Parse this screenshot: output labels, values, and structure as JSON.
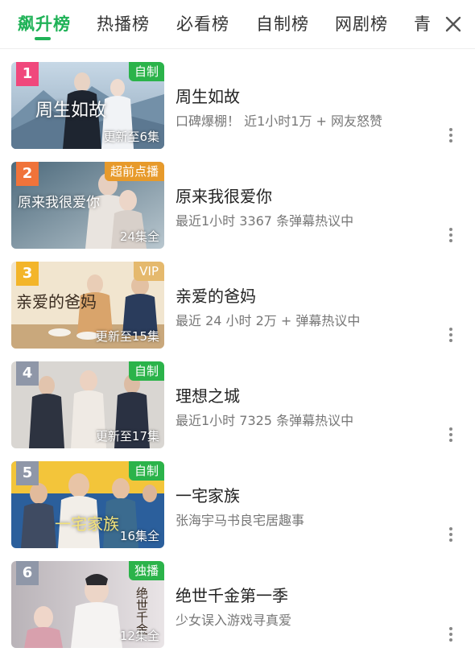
{
  "tabs": [
    {
      "label": "飙升榜",
      "active": true
    },
    {
      "label": "热播榜",
      "active": false
    },
    {
      "label": "必看榜",
      "active": false
    },
    {
      "label": "自制榜",
      "active": false
    },
    {
      "label": "网剧榜",
      "active": false
    },
    {
      "label": "青",
      "active": false
    }
  ],
  "colors": {
    "accent": "#1fb257"
  },
  "items": [
    {
      "rank": "1",
      "rank_color": "#f0487c",
      "badge": "自制",
      "badge_color": "#2bb34a",
      "episodes": "更新至6集",
      "poster_text": "周生如故",
      "title": "周生如故",
      "desc": "口碑爆棚！ 近1小时1万 + 网友怒赞"
    },
    {
      "rank": "2",
      "rank_color": "#f0733a",
      "badge": "超前点播",
      "badge_color": "#e79a2b",
      "episodes": "24集全",
      "poster_text": "原来我很爱你",
      "title": "原来我很爱你",
      "desc": "最近1小时 3367 条弹幕热议中"
    },
    {
      "rank": "3",
      "rank_color": "#f3b52a",
      "badge": "VIP",
      "badge_color": "#e5b96d",
      "episodes": "更新至15集",
      "poster_text": "亲爱的爸妈",
      "title": "亲爱的爸妈",
      "desc": "最近 24 小时 2万 + 弹幕热议中"
    },
    {
      "rank": "4",
      "rank_color": "#8f97a8",
      "badge": "自制",
      "badge_color": "#2bb34a",
      "episodes": "更新至17集",
      "poster_text": "",
      "title": "理想之城",
      "desc": "最近1小时 7325 条弹幕热议中"
    },
    {
      "rank": "5",
      "rank_color": "#8f97a8",
      "badge": "自制",
      "badge_color": "#2bb34a",
      "episodes": "16集全",
      "poster_text": "一宅家族",
      "title": "一宅家族",
      "desc": "张海宇马书良宅居趣事"
    },
    {
      "rank": "6",
      "rank_color": "#8f97a8",
      "badge": "独播",
      "badge_color": "#2bb34a",
      "episodes": "12集全",
      "poster_text": "绝世千金",
      "title": "绝世千金第一季",
      "desc": "少女误入游戏寻真爱"
    }
  ]
}
